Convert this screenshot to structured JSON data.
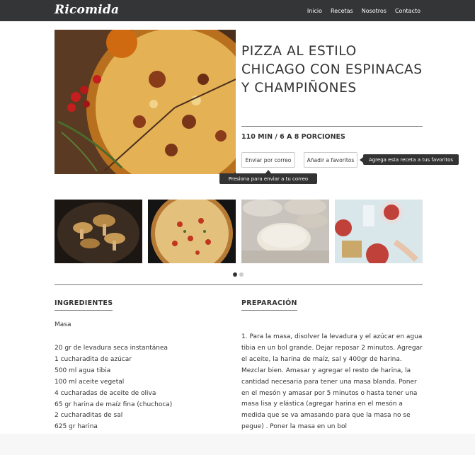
{
  "navbar": {
    "brand": "Ricomida",
    "links": [
      "Inicio",
      "Recetas",
      "Nosotros",
      "Contacto"
    ]
  },
  "recipe": {
    "title": "PIZZA AL ESTILO CHICAGO CON ESPINACAS Y CHAMPIÑONES",
    "meta": "110 MIN / 6 A 8 PORCIONES",
    "buttons": {
      "email": "Enviar por correo",
      "favorite": "Añadir a favoritos"
    },
    "tooltips": {
      "favorite": "Agrega esta receta a tus favoritos",
      "email": "Presiona para enviar a tu correo"
    }
  },
  "gallery": {
    "thumbnails": [
      "mushrooms-photo",
      "pizza-photo",
      "dough-photo",
      "fruit-photo"
    ],
    "active_dot": 1,
    "dot_count": 2
  },
  "ingredients": {
    "heading": "INGREDIENTES",
    "group": "Masa",
    "items": [
      "20 gr de levadura seca instantánea",
      "1 cucharadita de azúcar",
      "500 ml agua tibia",
      "100 ml aceite vegetal",
      "4 cucharadas de aceite de oliva",
      "65 gr harina de maíz fina (chuchoca)",
      "2 cucharaditas de sal",
      "625 gr harina"
    ]
  },
  "preparation": {
    "heading": "PREPARACIÓN",
    "text": "1. Para la masa, disolver la levadura y el azúcar en agua tibia en un bol grande.  Dejar reposar 2 minutos. Agregar el aceite, la harina de maíz, sal y 400gr de harina.  Mezclar bien.  Amasar y agregar el resto de harina, la cantidad necesaria para tener una masa blanda. Poner en el mesón y amasar por 5 minutos o hasta tener una masa lisa y elástica (agregar harina en el mesón a medida que se va amasando para que la masa no se pegue) . Poner la masa en un bol"
  },
  "colors": {
    "navbar": "#333536",
    "text": "#333333",
    "tooltip": "#333333"
  }
}
